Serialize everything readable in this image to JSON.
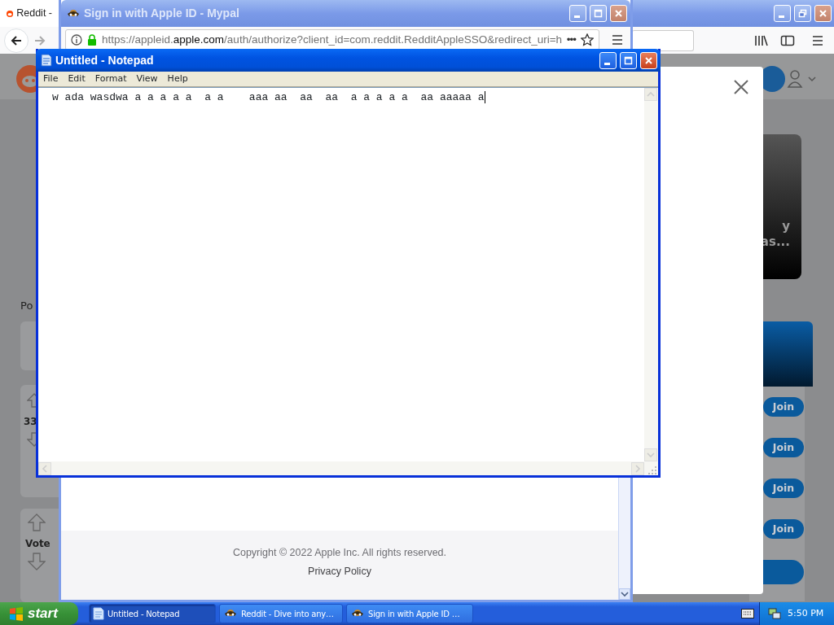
{
  "reddit_window": {
    "active": false,
    "tab_title": "Reddit -",
    "left_column": {
      "section_label": "Po",
      "score": "33",
      "vote_label": "Vote"
    },
    "right_column": {
      "card_text_lines": [
        "y",
        "as..."
      ],
      "join_buttons": [
        "Join",
        "Join",
        "Join",
        "Join"
      ]
    }
  },
  "apple_window": {
    "active": false,
    "title": "Sign in with Apple ID - Mypal",
    "url_parts": [
      {
        "text": "https://appleid.",
        "emphasis": false
      },
      {
        "text": "apple.com",
        "emphasis": true
      },
      {
        "text": "/auth/authorize?client_id=com.reddit.RedditAppleSSO&redirect_uri=h",
        "emphasis": false
      }
    ],
    "overflow": "•••",
    "copyright": "Copyright © 2022 Apple Inc. All rights reserved.",
    "privacy_link": "Privacy Policy"
  },
  "notepad": {
    "active": true,
    "title": "Untitled - Notepad",
    "menu": [
      "File",
      "Edit",
      "Format",
      "View",
      "Help"
    ],
    "text": "w ada wasdwa a a a a a  a a    aaa aa  aa  aa  a a a a a  aa aaaaa a"
  },
  "taskbar": {
    "start": "start",
    "tasks": [
      {
        "label": "Untitled - Notepad",
        "selected": true,
        "kind": "notepad"
      },
      {
        "label": "Reddit - Dive into any…",
        "selected": false,
        "kind": "browser"
      },
      {
        "label": "Sign in with Apple ID …",
        "selected": false,
        "kind": "browser"
      }
    ],
    "clock": "5:50 PM"
  }
}
